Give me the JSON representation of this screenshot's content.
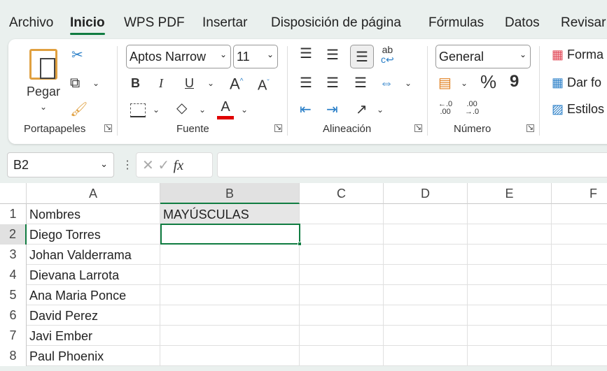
{
  "menu": [
    "Archivo",
    "Inicio",
    "WPS PDF",
    "Insertar",
    "Disposición de página",
    "Fórmulas",
    "Datos",
    "Revisar"
  ],
  "ribbon": {
    "clipboard": {
      "paste": "Pegar",
      "group": "Portapapeles"
    },
    "font": {
      "name": "Aptos Narrow",
      "size": "11",
      "bold": "B",
      "italic": "I",
      "underline": "U",
      "grow": "A",
      "shrink": "A",
      "color": "A",
      "group": "Fuente",
      "font_color": "#e00000"
    },
    "alignment": {
      "group": "Alineación"
    },
    "number": {
      "format": "General",
      "percent": "%",
      "comma": "9",
      "inc_decimal": "←.0\n.00",
      "dec_decimal": ".00\n→.0",
      "group": "Número"
    },
    "styles": [
      "Formato condicional",
      "Dar formato como tabla",
      "Estilos de celda"
    ],
    "styles_visible": [
      "Forma",
      "Dar fo",
      "Estilos"
    ]
  },
  "formula_bar": {
    "name_box": "B2",
    "fx": "fx",
    "formula": ""
  },
  "columns": [
    "A",
    "B",
    "C",
    "D",
    "E",
    "F"
  ],
  "rows": [
    {
      "n": "1",
      "a": "Nombres",
      "b": "MAYÚSCULAS"
    },
    {
      "n": "2",
      "a": "Diego Torres",
      "b": ""
    },
    {
      "n": "3",
      "a": "Johan Valderrama",
      "b": ""
    },
    {
      "n": "4",
      "a": "Dievana Larrota",
      "b": ""
    },
    {
      "n": "5",
      "a": "Ana Maria Ponce",
      "b": ""
    },
    {
      "n": "6",
      "a": "David Perez",
      "b": ""
    },
    {
      "n": "7",
      "a": "Javi Ember",
      "b": ""
    },
    {
      "n": "8",
      "a": "Paul Phoenix",
      "b": ""
    }
  ],
  "selected_cell": "B2",
  "accent": "#107c41"
}
